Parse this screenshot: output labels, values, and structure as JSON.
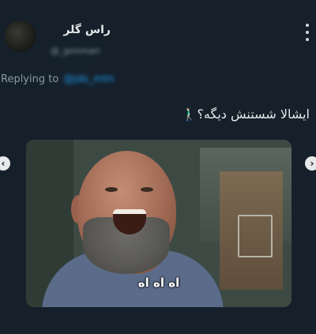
{
  "post": {
    "display_name": "راس گلر",
    "handle": "@_jpmmarr",
    "replying_to_label": "Replying to",
    "replying_to_mention": "@jds_mtn",
    "text": "ایشالا شستنش دیگه؟🚶🏻‍♂️",
    "more_icon": "more-vertical-icon"
  },
  "media": {
    "subtitle": "اه اه اه",
    "prev_icon": "chevron-left-icon",
    "next_icon": "chevron-right-icon",
    "prev_glyph": "‹",
    "next_glyph": "›"
  },
  "colors": {
    "background": "#15202b",
    "text": "#e7e9ea",
    "secondary": "#8b98a5",
    "link": "#1d9bf0"
  }
}
